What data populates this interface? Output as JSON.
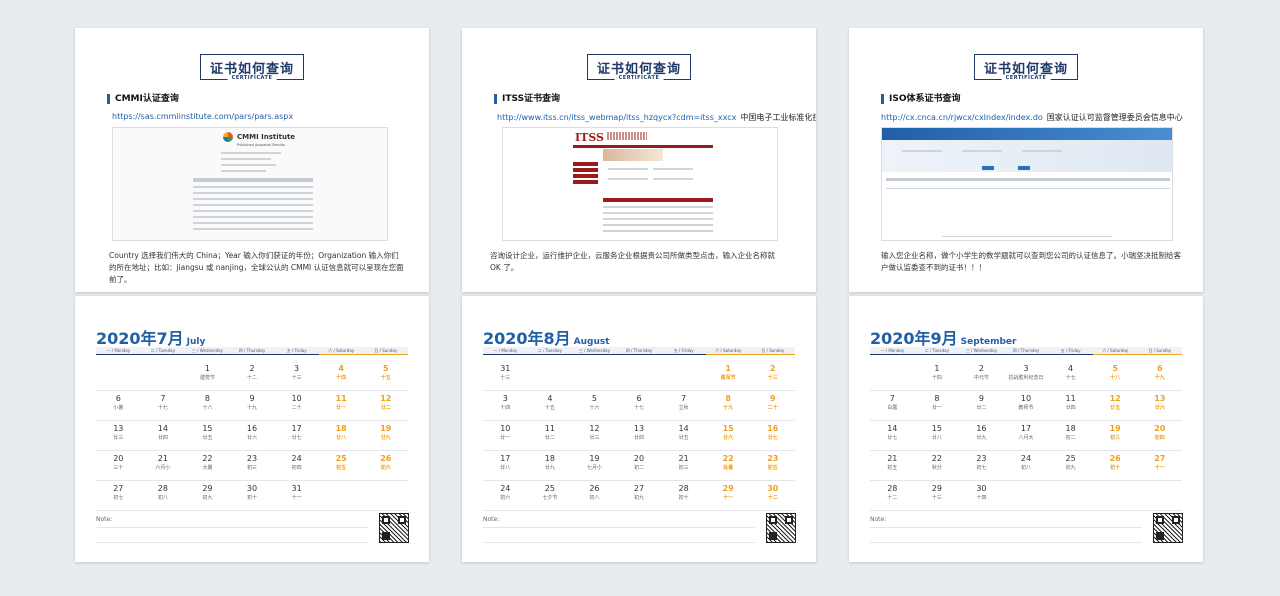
{
  "certificate": {
    "title": "证书如何查询",
    "subtitle": "CERTIFICATE",
    "panels": [
      {
        "heading": "CMMI认证查询",
        "url": "https://sas.cmmiinstitute.com/pars/pars.aspx",
        "org": "",
        "logo": "CMMI Institute",
        "logo_sub": "Published Appraisal Results",
        "description": "Country 选择我们伟大的 China；Year 输入你们获证的年份；Organization 输入你们的所在地址；比如：jiangsu 或 nanjing，全球公认的 CMMI 认证信息就可以呈现在您面前了。"
      },
      {
        "heading": "ITSS证书查询",
        "url": "http://www.itss.cn/itss_webmap/itss_hzqycx?cdm=itss_xxcx",
        "org": "中国电子工业标准化技术协会",
        "logo": "ITSS",
        "logo_sub": "",
        "description": "咨询设计企业，运行维护企业，云服务企业根据贵公司所做类型点击，输入企业名称就 OK 了。"
      },
      {
        "heading": "ISO体系证书查询",
        "url": "http://cx.cnca.cn/rjwcx/cxIndex/index.do",
        "org": "国家认证认可监督管理委员会信息中心",
        "logo": "",
        "logo_sub": "",
        "description": "输入您企业名称，做个小学生的数学题就可以查到您公司的认证信息了。小瑞坚决抵制给客户做认监委查不到的证书！！！"
      }
    ]
  },
  "weekdays": [
    "一 / Monday",
    "二 / Tuesday",
    "三 / Wednesday",
    "四 / Thursday",
    "五 / Friday",
    "六 / Saturday",
    "日 / Sunday"
  ],
  "note_label": "Note:",
  "calendars": [
    {
      "title": "2020年7月",
      "title_en": "July",
      "weeks": [
        [
          null,
          null,
          {
            "d": "1",
            "l": "建党节"
          },
          {
            "d": "2",
            "l": "十二"
          },
          {
            "d": "3",
            "l": "十三"
          },
          {
            "d": "4",
            "l": "十四"
          },
          {
            "d": "5",
            "l": "十五"
          }
        ],
        [
          {
            "d": "6",
            "l": "小暑"
          },
          {
            "d": "7",
            "l": "十七"
          },
          {
            "d": "8",
            "l": "十八"
          },
          {
            "d": "9",
            "l": "十九"
          },
          {
            "d": "10",
            "l": "二十"
          },
          {
            "d": "11",
            "l": "廿一"
          },
          {
            "d": "12",
            "l": "廿二"
          }
        ],
        [
          {
            "d": "13",
            "l": "廿三"
          },
          {
            "d": "14",
            "l": "廿四"
          },
          {
            "d": "15",
            "l": "廿五"
          },
          {
            "d": "16",
            "l": "廿六"
          },
          {
            "d": "17",
            "l": "廿七"
          },
          {
            "d": "18",
            "l": "廿八"
          },
          {
            "d": "19",
            "l": "廿九"
          }
        ],
        [
          {
            "d": "20",
            "l": "三十"
          },
          {
            "d": "21",
            "l": "六月小"
          },
          {
            "d": "22",
            "l": "大暑"
          },
          {
            "d": "23",
            "l": "初三"
          },
          {
            "d": "24",
            "l": "初四"
          },
          {
            "d": "25",
            "l": "初五"
          },
          {
            "d": "26",
            "l": "初六"
          }
        ],
        [
          {
            "d": "27",
            "l": "初七"
          },
          {
            "d": "28",
            "l": "初八"
          },
          {
            "d": "29",
            "l": "初九"
          },
          {
            "d": "30",
            "l": "初十"
          },
          {
            "d": "31",
            "l": "十一"
          },
          null,
          null
        ]
      ]
    },
    {
      "title": "2020年8月",
      "title_en": "August",
      "weeks": [
        [
          {
            "d": "31",
            "l": "十三"
          },
          null,
          null,
          null,
          null,
          {
            "d": "1",
            "l": "建军节"
          },
          {
            "d": "2",
            "l": "十三"
          }
        ],
        [
          {
            "d": "3",
            "l": "十四"
          },
          {
            "d": "4",
            "l": "十五"
          },
          {
            "d": "5",
            "l": "十六"
          },
          {
            "d": "6",
            "l": "十七"
          },
          {
            "d": "7",
            "l": "立秋"
          },
          {
            "d": "8",
            "l": "十九"
          },
          {
            "d": "9",
            "l": "二十"
          }
        ],
        [
          {
            "d": "10",
            "l": "廿一"
          },
          {
            "d": "11",
            "l": "廿二"
          },
          {
            "d": "12",
            "l": "廿三"
          },
          {
            "d": "13",
            "l": "廿四"
          },
          {
            "d": "14",
            "l": "廿五"
          },
          {
            "d": "15",
            "l": "廿六"
          },
          {
            "d": "16",
            "l": "廿七"
          }
        ],
        [
          {
            "d": "17",
            "l": "廿八"
          },
          {
            "d": "18",
            "l": "廿九"
          },
          {
            "d": "19",
            "l": "七月小"
          },
          {
            "d": "20",
            "l": "初二"
          },
          {
            "d": "21",
            "l": "初三"
          },
          {
            "d": "22",
            "l": "处暑"
          },
          {
            "d": "23",
            "l": "初五"
          }
        ],
        [
          {
            "d": "24",
            "l": "初六"
          },
          {
            "d": "25",
            "l": "七夕节"
          },
          {
            "d": "26",
            "l": "初八"
          },
          {
            "d": "27",
            "l": "初九"
          },
          {
            "d": "28",
            "l": "初十"
          },
          {
            "d": "29",
            "l": "十一"
          },
          {
            "d": "30",
            "l": "十二"
          }
        ]
      ]
    },
    {
      "title": "2020年9月",
      "title_en": "September",
      "weeks": [
        [
          null,
          {
            "d": "1",
            "l": "十四"
          },
          {
            "d": "2",
            "l": "中元节"
          },
          {
            "d": "3",
            "l": "抗战胜利纪念日"
          },
          {
            "d": "4",
            "l": "十七"
          },
          {
            "d": "5",
            "l": "十八"
          },
          {
            "d": "6",
            "l": "十九"
          }
        ],
        [
          {
            "d": "7",
            "l": "白露"
          },
          {
            "d": "8",
            "l": "廿一"
          },
          {
            "d": "9",
            "l": "廿二"
          },
          {
            "d": "10",
            "l": "教师节"
          },
          {
            "d": "11",
            "l": "廿四"
          },
          {
            "d": "12",
            "l": "廿五"
          },
          {
            "d": "13",
            "l": "廿六"
          }
        ],
        [
          {
            "d": "14",
            "l": "廿七"
          },
          {
            "d": "15",
            "l": "廿八"
          },
          {
            "d": "16",
            "l": "廿九"
          },
          {
            "d": "17",
            "l": "八月大"
          },
          {
            "d": "18",
            "l": "初二"
          },
          {
            "d": "19",
            "l": "初三"
          },
          {
            "d": "20",
            "l": "初四"
          }
        ],
        [
          {
            "d": "21",
            "l": "初五"
          },
          {
            "d": "22",
            "l": "秋分"
          },
          {
            "d": "23",
            "l": "初七"
          },
          {
            "d": "24",
            "l": "初八"
          },
          {
            "d": "25",
            "l": "初九"
          },
          {
            "d": "26",
            "l": "初十"
          },
          {
            "d": "27",
            "l": "十一"
          }
        ],
        [
          {
            "d": "28",
            "l": "十二"
          },
          {
            "d": "29",
            "l": "十三"
          },
          {
            "d": "30",
            "l": "十四"
          },
          null,
          null,
          null,
          null
        ]
      ]
    }
  ],
  "colors": {
    "brand_blue": "#1f5fa8",
    "navy": "#1f3a6a",
    "weekend": "#f0a020",
    "itss_red": "#9a1b1b"
  }
}
